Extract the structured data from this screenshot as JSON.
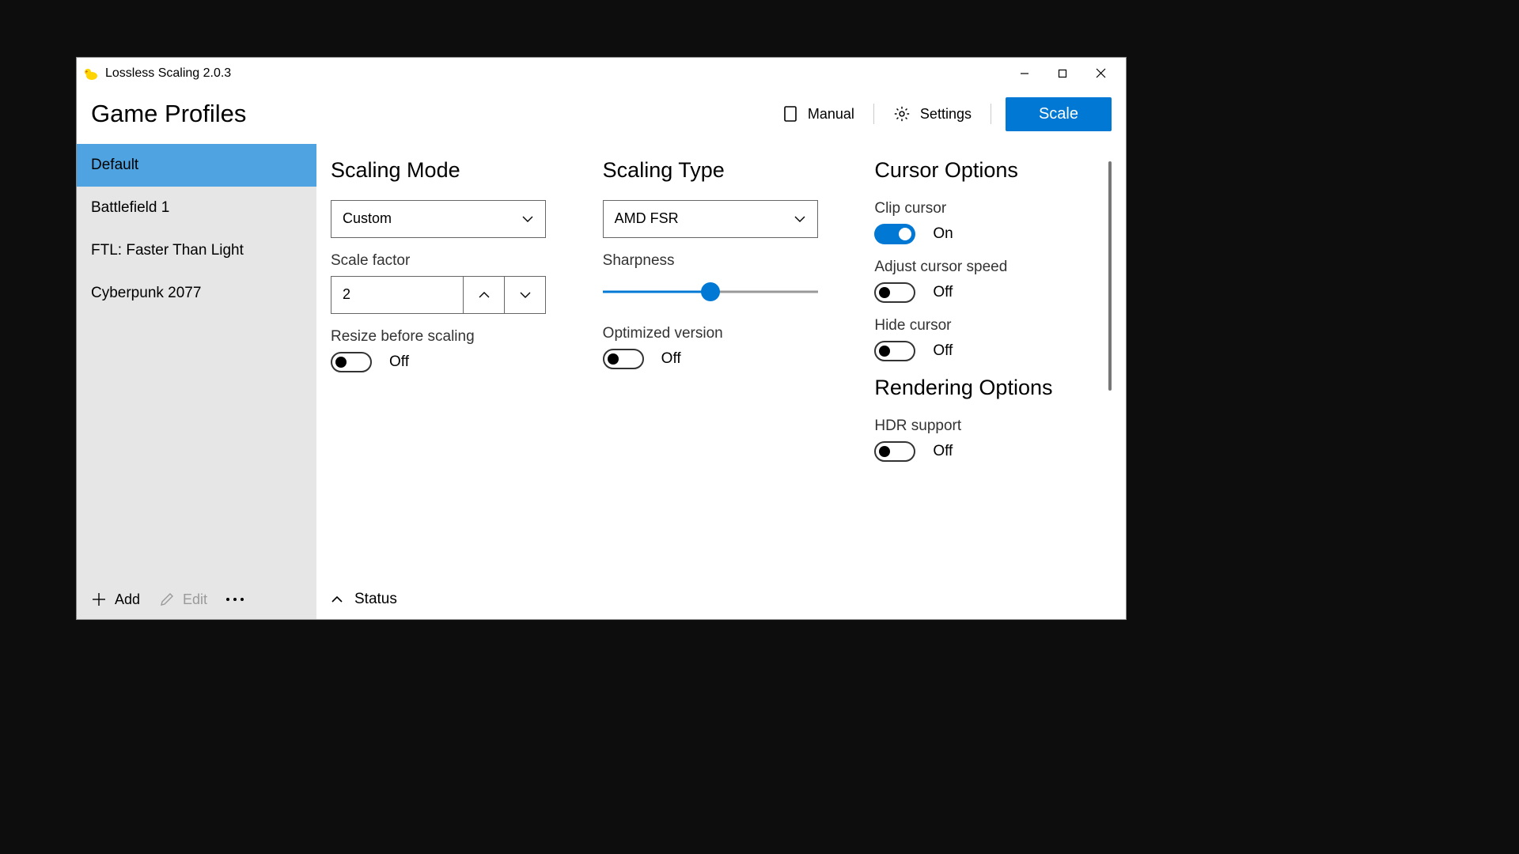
{
  "titlebar": {
    "title": "Lossless Scaling 2.0.3"
  },
  "header": {
    "page_title": "Game Profiles",
    "manual": "Manual",
    "settings": "Settings",
    "scale": "Scale"
  },
  "sidebar": {
    "profiles": [
      {
        "label": "Default",
        "selected": true
      },
      {
        "label": "Battlefield 1",
        "selected": false
      },
      {
        "label": "FTL: Faster Than Light",
        "selected": false
      },
      {
        "label": "Cyberpunk 2077",
        "selected": false
      }
    ],
    "add_label": "Add",
    "edit_label": "Edit"
  },
  "scaling_mode": {
    "title": "Scaling Mode",
    "dropdown_value": "Custom",
    "scale_factor_label": "Scale factor",
    "scale_factor_value": "2",
    "resize_label": "Resize before scaling",
    "resize_state": "Off"
  },
  "scaling_type": {
    "title": "Scaling Type",
    "dropdown_value": "AMD FSR",
    "sharpness_label": "Sharpness",
    "sharpness_percent": 50,
    "optimized_label": "Optimized version",
    "optimized_state": "Off"
  },
  "cursor_options": {
    "title": "Cursor Options",
    "clip_label": "Clip cursor",
    "clip_state": "On",
    "adjust_label": "Adjust cursor speed",
    "adjust_state": "Off",
    "hide_label": "Hide cursor",
    "hide_state": "Off"
  },
  "rendering_options": {
    "title": "Rendering Options",
    "hdr_label": "HDR support",
    "hdr_state": "Off"
  },
  "status": {
    "label": "Status"
  }
}
